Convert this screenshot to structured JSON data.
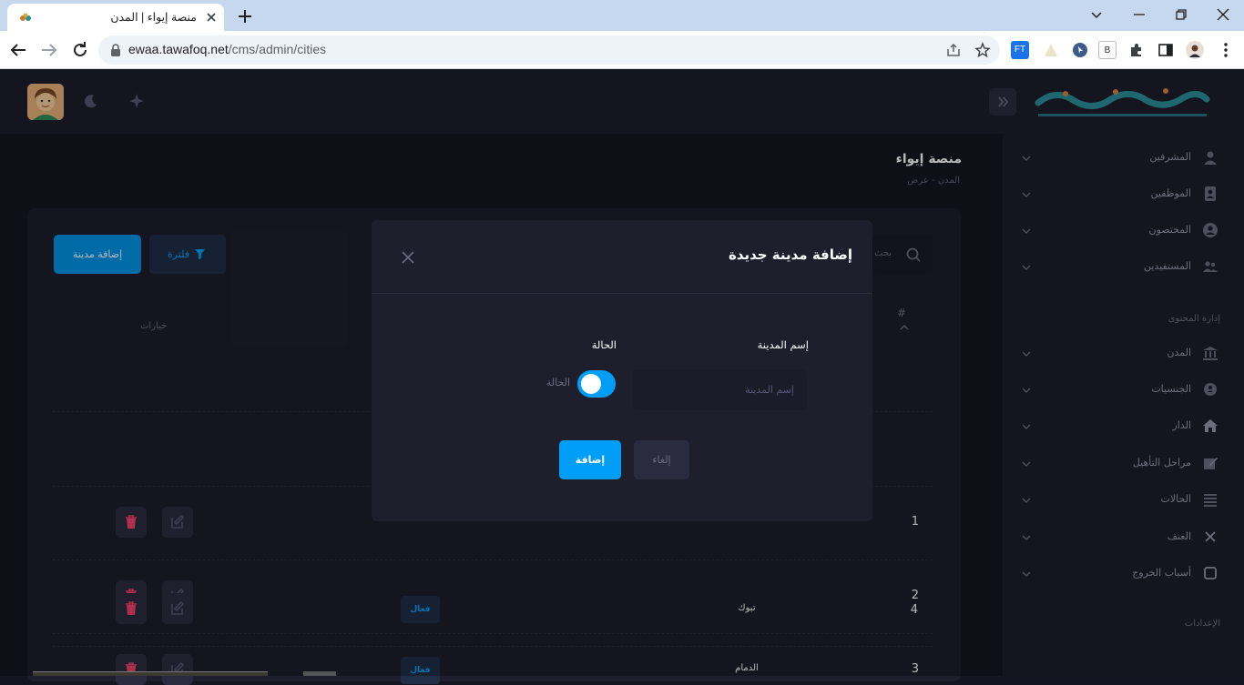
{
  "browser": {
    "tab_title": "منصة إيواء | المدن",
    "url_host": "ewaa.tawafoq.net",
    "url_path": "/cms/admin/cities",
    "extensions": [
      "FT",
      "B"
    ]
  },
  "header": {
    "icons": [
      "avatar",
      "moon-icon",
      "sparkle-icon",
      "collapse-icon",
      "logo"
    ]
  },
  "sidebar": {
    "items": [
      {
        "label": "المشرفين",
        "icon": "user-icon"
      },
      {
        "label": "الموظفين",
        "icon": "contact-book-icon"
      },
      {
        "label": "المختصون",
        "icon": "user-circle-icon"
      },
      {
        "label": "المستفيدين",
        "icon": "users-icon"
      }
    ],
    "section_content": "إدارة المحتوى",
    "content_items": [
      {
        "label": "المدن",
        "icon": "bank-icon"
      },
      {
        "label": "الجنسيات",
        "icon": "badge-icon"
      },
      {
        "label": "الدار",
        "icon": "home-icon"
      },
      {
        "label": "مراحل التأهيل",
        "icon": "pencil-icon"
      },
      {
        "label": "الحالات",
        "icon": "list-icon"
      },
      {
        "label": "العنف",
        "icon": "x-icon"
      },
      {
        "label": "أسباب الخروج",
        "icon": "square-icon"
      }
    ],
    "section_settings": "الإعدادات"
  },
  "page": {
    "title": "منصة إيواء",
    "breadcrumb": "المدن  -  عرض"
  },
  "toolbar": {
    "add_city_label": "إضافة مدينة",
    "filter_label": "فلترة",
    "search_placeholder": "بحث"
  },
  "table": {
    "col_num": "#",
    "col_options": "خيارات",
    "rows": [
      {
        "num": "1",
        "city": "",
        "status": ""
      },
      {
        "num": "2",
        "city": "",
        "status": ""
      },
      {
        "num": "3",
        "city": "الدمام",
        "status": "فعال"
      },
      {
        "num": "4",
        "city": "تبوك",
        "status": "فعال"
      }
    ]
  },
  "modal": {
    "title": "إضافة مدينة جديدة",
    "city_label": "إسم المدينة",
    "city_placeholder": "إسم المدينة",
    "status_label": "الحالة",
    "toggle_label": "الحالة",
    "toggle_on": true,
    "submit_label": "إضافة",
    "cancel_label": "إلغاء"
  },
  "colors": {
    "primary": "#009ef7",
    "danger": "#f1416c",
    "surface": "#1e1e2d",
    "background": "#151521"
  }
}
